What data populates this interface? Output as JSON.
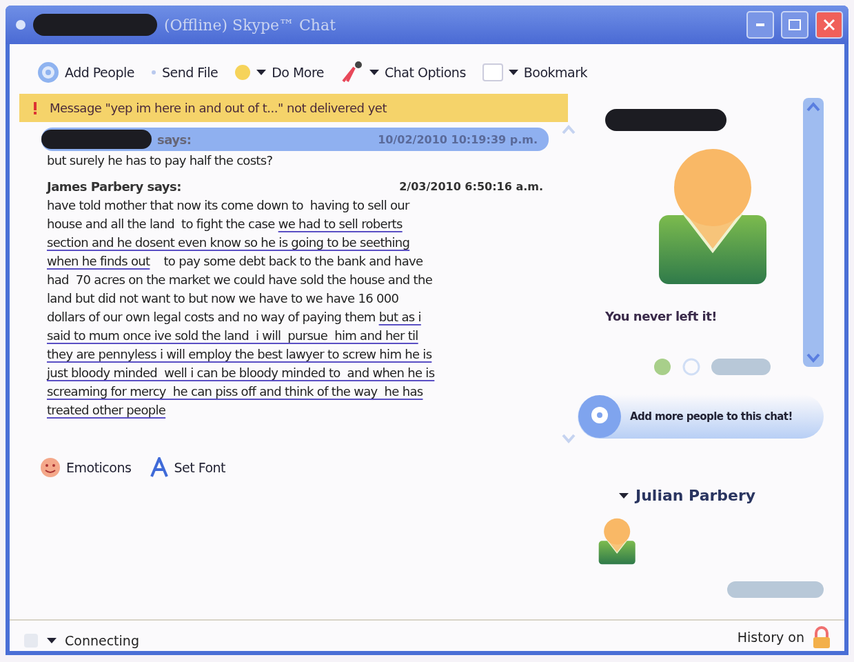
{
  "window": {
    "title": "(Offline) Skype™ Chat",
    "title_redacted": true
  },
  "toolbar": [
    {
      "label": "Add People",
      "dropdown": false
    },
    {
      "label": "Send File",
      "dropdown": false
    },
    {
      "label": "Do More",
      "dropdown": true
    },
    {
      "label": "Chat Options",
      "dropdown": true
    },
    {
      "label": "Bookmark",
      "dropdown": true
    }
  ],
  "alert": {
    "text": "Message \"yep im here in and out of t...\" not delivered yet"
  },
  "messages": [
    {
      "kind": "highlighted",
      "sender": "says:",
      "sender_redacted": true,
      "time": "10/02/2010 10:19:39 p.m.",
      "lines": [
        [
          {
            "text": "but surely he has to pay half the costs?",
            "underlined": false
          }
        ]
      ]
    },
    {
      "kind": "plain",
      "sender": "James Parbery says:",
      "sender_redacted": false,
      "time": "2/03/2010 6:50:16 a.m.",
      "lines": [
        [
          {
            "text": "have told mother that now its come down to  having to sell our",
            "underlined": false
          }
        ],
        [
          {
            "text": "house and all the land  to fight the case ",
            "underlined": false
          },
          {
            "text": "we had to sell roberts",
            "underlined": true
          }
        ],
        [
          {
            "text": "section and he dosent even know so he is going to be seething",
            "underlined": true
          }
        ],
        [
          {
            "text": "when he finds out",
            "underlined": true
          },
          {
            "text": "    to pay some debt back to the bank and have",
            "underlined": false
          }
        ],
        [
          {
            "text": "had  70 acres on the market we could have sold the house and the",
            "underlined": false
          }
        ],
        [
          {
            "text": "land but did not want to but now we have to we have 16 000",
            "underlined": false
          }
        ],
        [
          {
            "text": "dollars of our own legal costs and no way of paying them ",
            "underlined": false
          },
          {
            "text": "but as i",
            "underlined": true
          }
        ],
        [
          {
            "text": "said to mum once ive sold the land  i will  pursue  him and her til",
            "underlined": true
          }
        ],
        [
          {
            "text": "they are pennyless i will employ the best lawyer to screw him he is",
            "underlined": true
          }
        ],
        [
          {
            "text": "just bloody minded  well i can be bloody minded to  and when he is",
            "underlined": true
          }
        ],
        [
          {
            "text": "screaming for mercy  he can piss off and think of the way  he has",
            "underlined": true
          }
        ],
        [
          {
            "text": "treated other people",
            "underlined": true
          }
        ]
      ]
    }
  ],
  "compose_tools": [
    {
      "label": "Emoticons"
    },
    {
      "label": "Set Font"
    }
  ],
  "profile": {
    "name_redacted": true,
    "mood": "You never left it!",
    "add_more": "Add more people to this chat!"
  },
  "participants": {
    "group": "Julian Parbery",
    "expanded": true
  },
  "status_bar": {
    "status": "Connecting",
    "history": "History on"
  }
}
